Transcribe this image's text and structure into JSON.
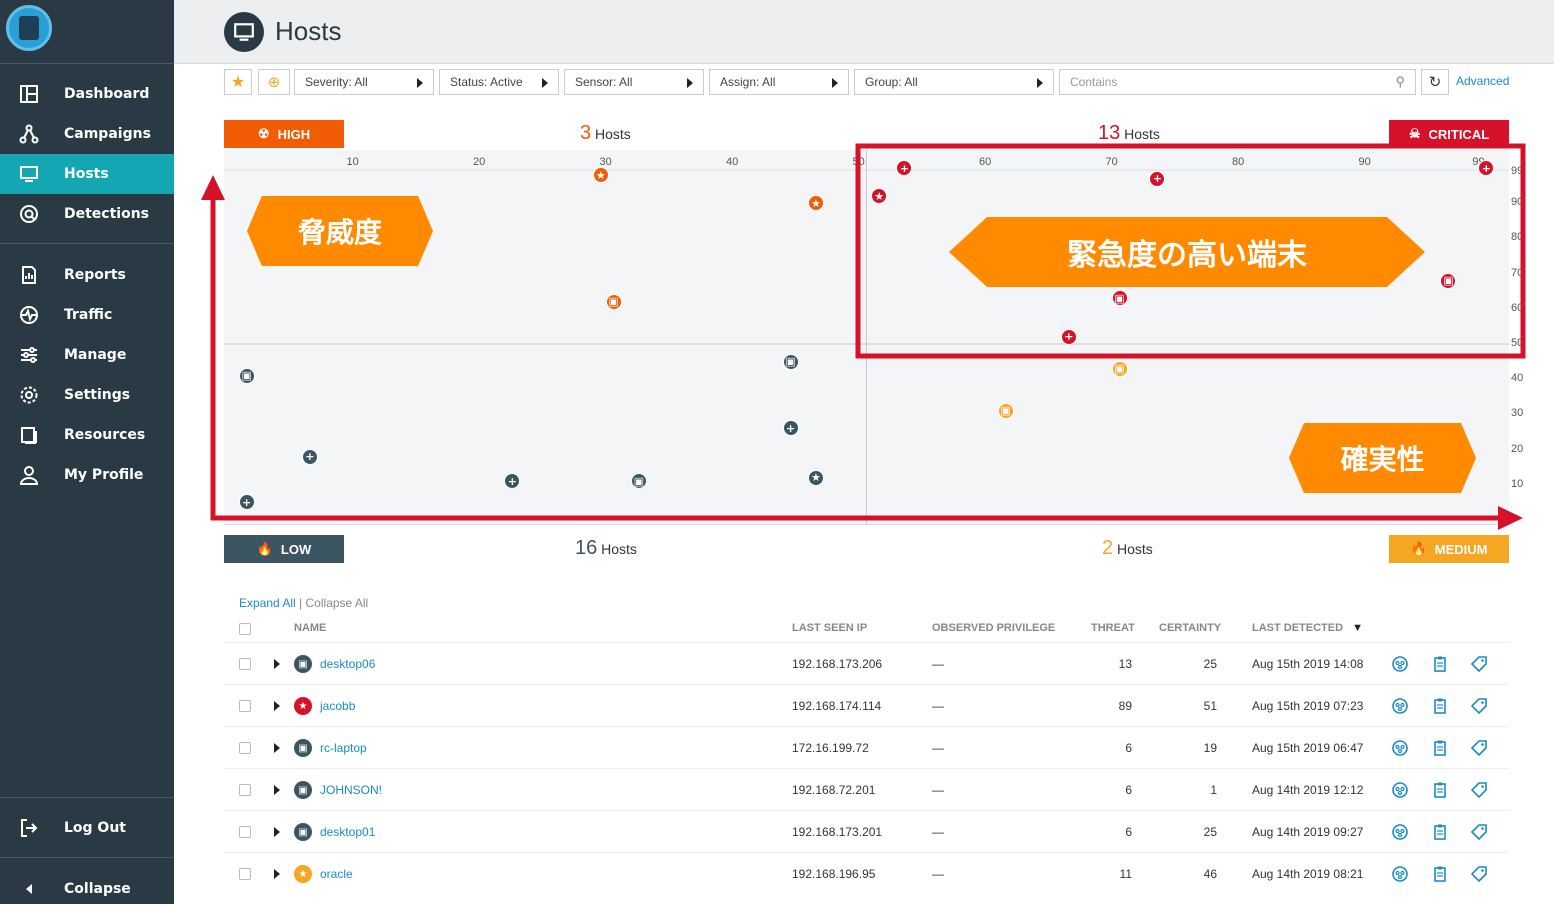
{
  "sidebar": {
    "items": [
      {
        "label": "Dashboard"
      },
      {
        "label": "Campaigns"
      },
      {
        "label": "Hosts"
      },
      {
        "label": "Detections"
      },
      {
        "label": "Reports"
      },
      {
        "label": "Traffic"
      },
      {
        "label": "Manage"
      },
      {
        "label": "Settings"
      },
      {
        "label": "Resources"
      },
      {
        "label": "My Profile"
      }
    ],
    "logout": "Log Out",
    "collapse": "Collapse",
    "active": "Hosts"
  },
  "header": {
    "title": "Hosts"
  },
  "filters": {
    "severity": "Severity: All",
    "status": "Status: Active",
    "sensor": "Sensor: All",
    "assign": "Assign: All",
    "group": "Group: All",
    "search_placeholder": "Contains",
    "advanced": "Advanced"
  },
  "quadrants": {
    "high": {
      "label": "HIGH",
      "count": "3",
      "unit": "Hosts",
      "color": "#f25c05"
    },
    "critical": {
      "label": "CRITICAL",
      "count": "13",
      "unit": "Hosts",
      "color": "#d6122a"
    },
    "low": {
      "label": "LOW",
      "count": "16",
      "unit": "Hosts",
      "color": "#3b5563"
    },
    "medium": {
      "label": "MEDIUM",
      "count": "2",
      "unit": "Hosts",
      "color": "#f5a623"
    }
  },
  "annotations": {
    "threat": "脅威度",
    "critical_hosts": "緊急度の高い端末",
    "certainty": "確実性"
  },
  "chart_data": {
    "type": "scatter",
    "xlabel": "Certainty",
    "x_ticks": [
      10,
      20,
      30,
      40,
      50,
      60,
      70,
      80,
      90,
      99
    ],
    "y_ticks": [
      10,
      20,
      30,
      40,
      50,
      60,
      70,
      80,
      90,
      99
    ],
    "xlim": [
      0,
      100
    ],
    "ylim": [
      0,
      100
    ],
    "points": [
      {
        "x": 29,
        "y": 98,
        "quadrant": "high",
        "icon": "star"
      },
      {
        "x": 46,
        "y": 90,
        "quadrant": "high",
        "icon": "star"
      },
      {
        "x": 30,
        "y": 62,
        "quadrant": "high",
        "icon": "host"
      },
      {
        "x": 53,
        "y": 100,
        "quadrant": "critical",
        "icon": "plus"
      },
      {
        "x": 51,
        "y": 92,
        "quadrant": "critical",
        "icon": "star"
      },
      {
        "x": 73,
        "y": 97,
        "quadrant": "critical",
        "icon": "plus"
      },
      {
        "x": 99,
        "y": 100,
        "quadrant": "critical",
        "icon": "plus"
      },
      {
        "x": 96,
        "y": 68,
        "quadrant": "critical",
        "icon": "host"
      },
      {
        "x": 70,
        "y": 63,
        "quadrant": "critical",
        "icon": "host"
      },
      {
        "x": 66,
        "y": 52,
        "quadrant": "critical",
        "icon": "plus"
      },
      {
        "x": 1,
        "y": 41,
        "quadrant": "low",
        "icon": "host"
      },
      {
        "x": 44,
        "y": 45,
        "quadrant": "low",
        "icon": "host"
      },
      {
        "x": 44,
        "y": 26,
        "quadrant": "low",
        "icon": "plus"
      },
      {
        "x": 6,
        "y": 18,
        "quadrant": "low",
        "icon": "plus"
      },
      {
        "x": 22,
        "y": 11,
        "quadrant": "low",
        "icon": "plus"
      },
      {
        "x": 32,
        "y": 11,
        "quadrant": "low",
        "icon": "host"
      },
      {
        "x": 46,
        "y": 12,
        "quadrant": "low",
        "icon": "star"
      },
      {
        "x": 1,
        "y": 5,
        "quadrant": "low",
        "icon": "plus"
      },
      {
        "x": 70,
        "y": 43,
        "quadrant": "medium",
        "icon": "host"
      },
      {
        "x": 61,
        "y": 31,
        "quadrant": "medium",
        "icon": "host"
      }
    ]
  },
  "table": {
    "expand_all": "Expand All",
    "collapse_all": "Collapse All",
    "columns": [
      "NAME",
      "LAST SEEN IP",
      "OBSERVED PRIVILEGE",
      "THREAT",
      "CERTAINTY",
      "LAST DETECTED"
    ],
    "rows": [
      {
        "name": "desktop06",
        "ip": "192.168.173.206",
        "priv": "—",
        "threat": "13",
        "certainty": "25",
        "last": "Aug 15th 2019 14:08",
        "icon": "host",
        "color": "#3b5563"
      },
      {
        "name": "jacobb",
        "ip": "192.168.174.114",
        "priv": "—",
        "threat": "89",
        "certainty": "51",
        "last": "Aug 15th 2019 07:23",
        "icon": "star",
        "color": "#d6122a"
      },
      {
        "name": "rc-laptop",
        "ip": "172.16.199.72",
        "priv": "—",
        "threat": "6",
        "certainty": "19",
        "last": "Aug 15th 2019 06:47",
        "icon": "host",
        "color": "#3b5563"
      },
      {
        "name": "JOHNSON!",
        "ip": "192.168.72.201",
        "priv": "—",
        "threat": "6",
        "certainty": "1",
        "last": "Aug 14th 2019 12:12",
        "icon": "host",
        "color": "#3b5563"
      },
      {
        "name": "desktop01",
        "ip": "192.168.173.201",
        "priv": "—",
        "threat": "6",
        "certainty": "25",
        "last": "Aug 14th 2019 09:27",
        "icon": "host",
        "color": "#3b5563"
      },
      {
        "name": "oracle",
        "ip": "192.168.196.95",
        "priv": "—",
        "threat": "11",
        "certainty": "46",
        "last": "Aug 14th 2019 08:21",
        "icon": "star",
        "color": "#f5a623"
      }
    ]
  }
}
